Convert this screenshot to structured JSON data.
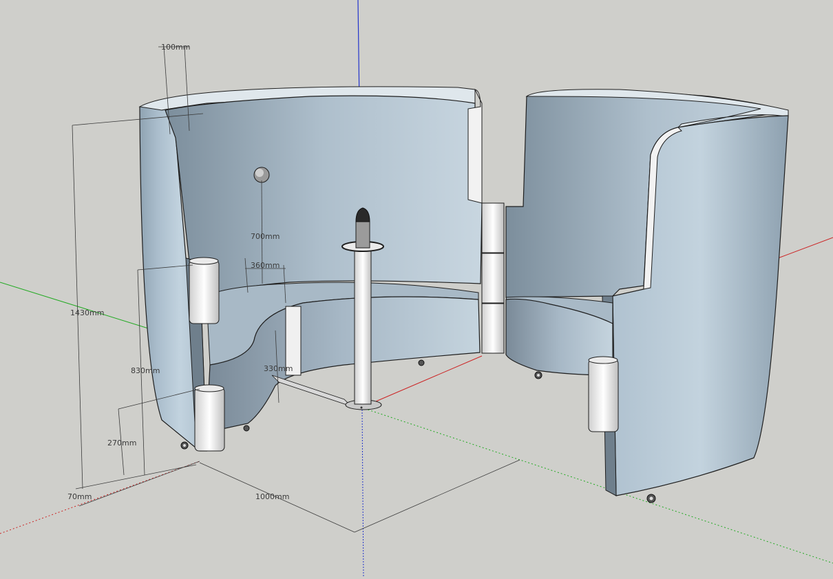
{
  "dimensions": {
    "d100": "100mm",
    "d1430": "1430mm",
    "d700": "700mm",
    "d360": "360mm",
    "d830": "830mm",
    "d330": "330mm",
    "d270": "270mm",
    "d70": "70mm",
    "d1000": "1000mm"
  },
  "colors": {
    "background": "#cfcfcb",
    "shell": "#b9c9d6",
    "axis_red": "#cc2222",
    "axis_green": "#22aa22",
    "axis_blue": "#2222cc"
  },
  "icons": [
    "axis-origin",
    "caster-wheel",
    "wall-light",
    "lamp-post"
  ]
}
